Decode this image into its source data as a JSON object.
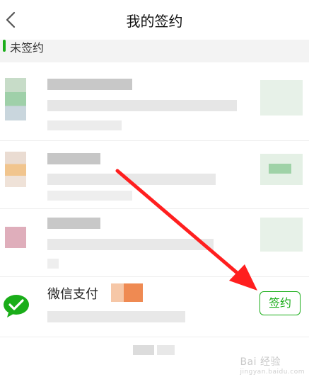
{
  "header": {
    "title": "我的签约"
  },
  "section": {
    "title": "未签约"
  },
  "wechat_pay": {
    "name": "微信支付",
    "button_label": "签约"
  },
  "watermark": {
    "text": "Bai 经验",
    "sub": "jingyan.baidu.com"
  },
  "colors": {
    "accent": "#1aad19",
    "arrow": "#ff1f1f"
  },
  "icons": {
    "back": "chevron-left-icon",
    "wechat_pay": "wechat-pay-icon"
  }
}
